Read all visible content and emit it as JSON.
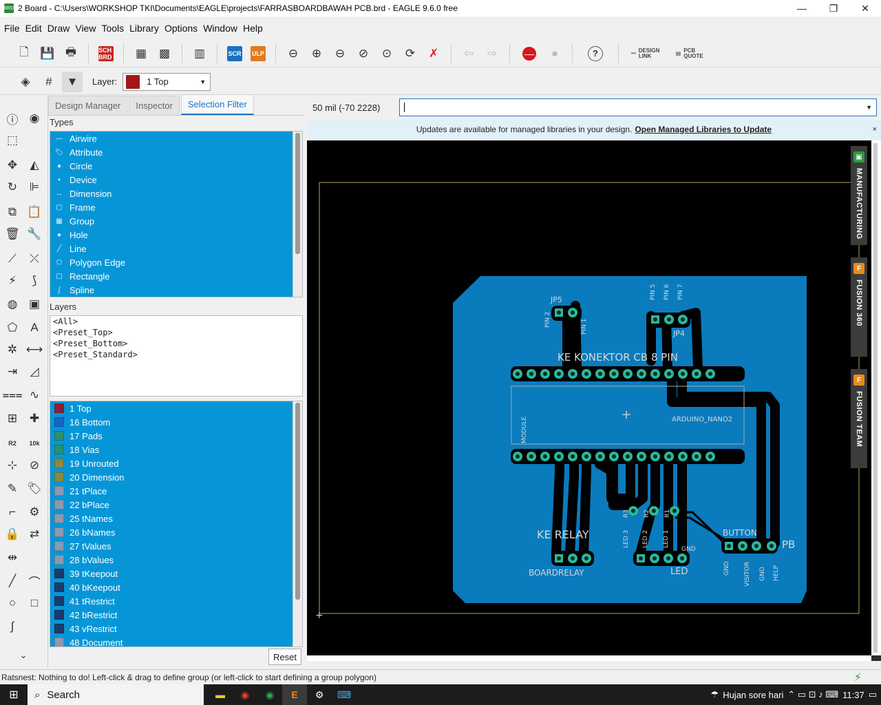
{
  "window": {
    "title": "2 Board - C:\\Users\\WORKSHOP TKI\\Documents\\EAGLE\\projects\\FARRASBOARDBAWAH PCB.brd - EAGLE 9.6.0 free",
    "app_icon": "BRD",
    "minimize": "—",
    "maximize": "❐",
    "close": "✕"
  },
  "menu": [
    "File",
    "Edit",
    "Draw",
    "View",
    "Tools",
    "Library",
    "Options",
    "Window",
    "Help"
  ],
  "toolbar": {
    "sch_brd": "SCH BRD",
    "scr": "SCR",
    "ulp": "ULP",
    "design_link": "DESIGN LINK",
    "pcb_quote": "PCB QUOTE",
    "help": "?"
  },
  "layer_bar": {
    "label": "Layer:",
    "selected": "1 Top",
    "selected_color": "#a31616"
  },
  "panel": {
    "tabs": [
      "Design Manager",
      "Inspector",
      "Selection Filter"
    ],
    "active_tab": "Selection Filter",
    "types_title": "Types",
    "types": [
      "Airwire",
      "Attribute",
      "Circle",
      "Device",
      "Dimension",
      "Frame",
      "Group",
      "Hole",
      "Line",
      "Polygon Edge",
      "Rectangle",
      "Spline"
    ],
    "layers_title": "Layers",
    "presets": [
      "<All>",
      "<Preset_Top>",
      "<Preset_Bottom>",
      "<Preset_Standard>"
    ],
    "layers": [
      {
        "name": "1 Top",
        "color": "#8a1f3c"
      },
      {
        "name": "16 Bottom",
        "color": "#1766c6"
      },
      {
        "name": "17 Pads",
        "color": "#2a8f6f"
      },
      {
        "name": "18 Vias",
        "color": "#2a8f6f"
      },
      {
        "name": "19 Unrouted",
        "color": "#8a8a3a"
      },
      {
        "name": "20 Dimension",
        "color": "#8a8a3a"
      },
      {
        "name": "21 tPlace",
        "color": "#8a9ab0"
      },
      {
        "name": "22 bPlace",
        "color": "#8a9ab0"
      },
      {
        "name": "25 tNames",
        "color": "#8a9ab0"
      },
      {
        "name": "26 bNames",
        "color": "#8a9ab0"
      },
      {
        "name": "27 tValues",
        "color": "#8a9ab0"
      },
      {
        "name": "28 bValues",
        "color": "#8a9ab0"
      },
      {
        "name": "39 tKeepout",
        "color": "#1b3a6a"
      },
      {
        "name": "40 bKeepout",
        "color": "#1b3a6a"
      },
      {
        "name": "41 tRestrict",
        "color": "#1b3a6a"
      },
      {
        "name": "42 bRestrict",
        "color": "#1b3a6a"
      },
      {
        "name": "43 vRestrict",
        "color": "#1b3a6a"
      },
      {
        "name": "48 Document",
        "color": "#8a9ab0"
      }
    ],
    "reset": "Reset"
  },
  "command": {
    "coords": "50 mil (-70 2228)",
    "value": ""
  },
  "notice": {
    "text": "Updates are available for managed libraries in your design.",
    "link": "Open Managed Libraries to Update",
    "close": "×"
  },
  "side_tabs": [
    "MANUFACTURING",
    "FUSION 360",
    "FUSION TEAM"
  ],
  "board": {
    "labels": {
      "jp5": "JP5",
      "pin2": "PIN 2",
      "pin1": "PIN 1",
      "pin5": "PIN 5",
      "pin6": "PIN 6",
      "pin7": "PIN 7",
      "jp4": "JP4",
      "konektor": "KE KONEKTOR CB 8 PIN",
      "module": "MODULE",
      "arduino": "ARDUINO_NANO2",
      "r3": "R3",
      "r2": "R2",
      "r1": "R1",
      "ke_relay": "KE RELAY",
      "boardrelay": "BOARDRELAY",
      "led3": "LED 3",
      "led2": "LED 2",
      "led1": "LED 1",
      "gnd_led": "GND",
      "led": "LED",
      "button": "BUTTON",
      "pb": "PB",
      "gnd_pb": "GND",
      "visitor": "VISITOR",
      "gnd2": "GND",
      "help": "HELP"
    }
  },
  "status": {
    "text": "Ratsnest: Nothing to do! Left-click & drag to define group (or left-click to start defining a group polygon)"
  },
  "taskbar": {
    "search": "Search",
    "weather": "Hujan sore hari",
    "time": "11:37"
  }
}
